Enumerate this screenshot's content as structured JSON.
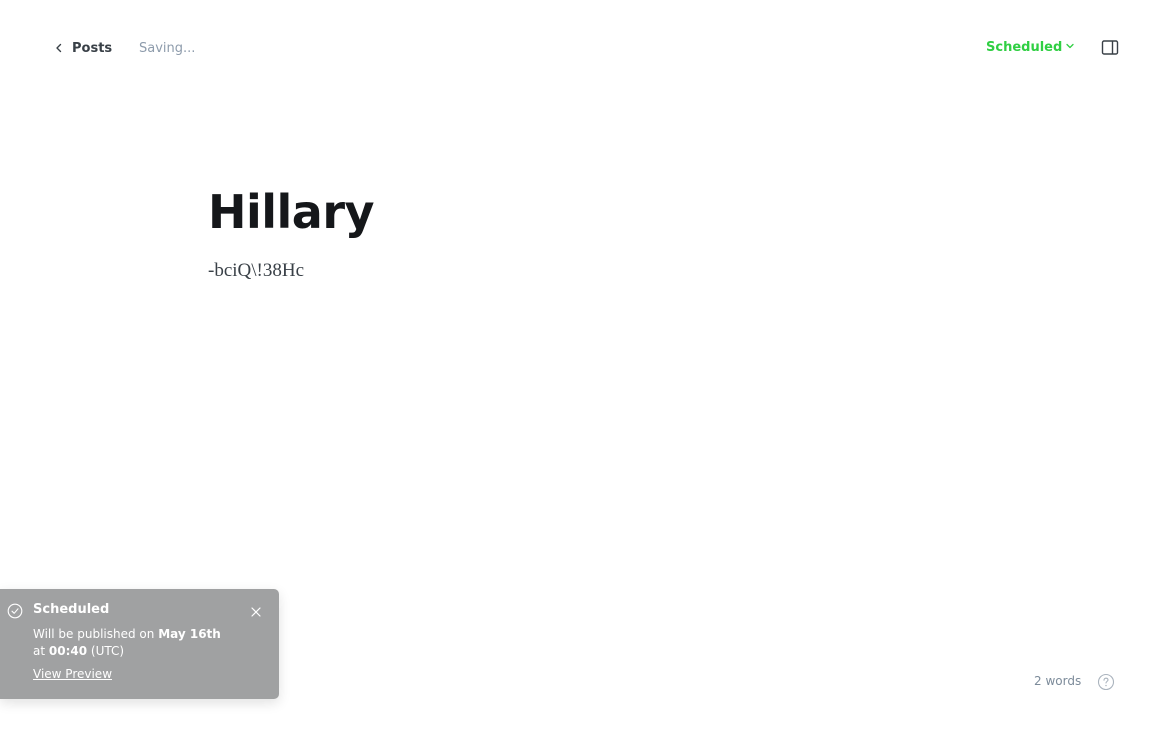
{
  "header": {
    "back_label": "Posts",
    "save_status": "Saving...",
    "status_label": "Scheduled"
  },
  "editor": {
    "title": "Hillary",
    "body": "-bciQ\\!38Hc"
  },
  "notification": {
    "title": "Scheduled",
    "line1_prefix": "Will be published on ",
    "date": "May 16th",
    "line2_prefix": "at ",
    "time": "00:40",
    "timezone": " (UTC)",
    "link_label": "View Preview"
  },
  "footer": {
    "word_count": "2 words"
  },
  "colors": {
    "accent_green": "#30cf43",
    "toast_bg": "#a0a1a2"
  },
  "icons": {
    "back": "chevron-left-icon",
    "status": "chevron-down-icon",
    "sidebar": "sidebar-toggle-icon",
    "toast": "check-circle-icon",
    "close": "close-icon",
    "help": "question-circle-icon"
  }
}
